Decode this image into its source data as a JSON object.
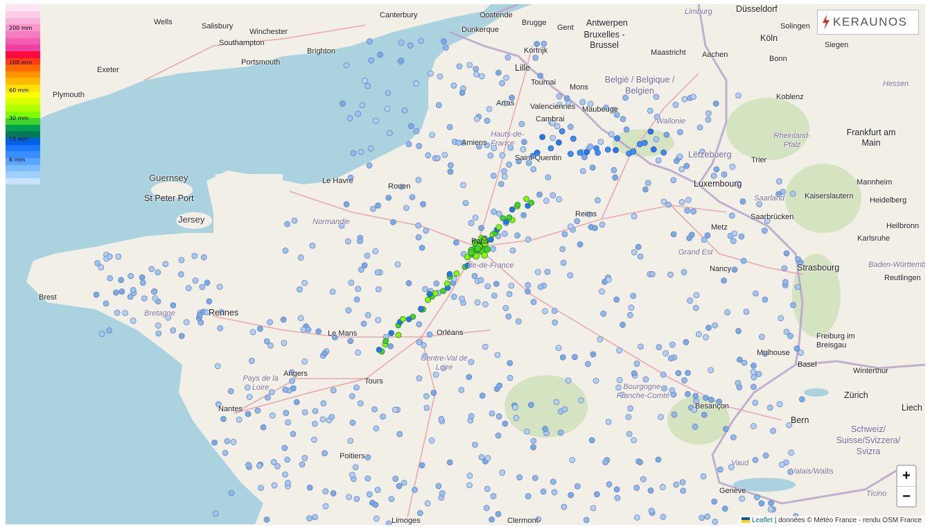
{
  "map": {
    "labels": {
      "wells": "Wells",
      "salisbury": "Salisbury",
      "winchester": "Winchester",
      "canterbury": "Canterbury",
      "oostende": "Oostende",
      "brugge": "Brugge",
      "gent": "Gent",
      "antwerpen": "Antwerpen",
      "brussel": "Bruxelles - Brussel",
      "limburg": "Limburg",
      "dusseldorf": "Düsseldorf",
      "southampton": "Southampton",
      "brighton": "Brighton",
      "dunkerque": "Dunkerque",
      "kortrijk": "Kortrijk",
      "maastricht": "Maastricht",
      "aachen": "Aachen",
      "koln": "Köln",
      "solingen": "Solingen",
      "exeter": "Exeter",
      "portsmouth": "Portsmouth",
      "lille": "Lille",
      "bonn": "Bonn",
      "siegen": "Siegen",
      "belgique": "België / Belgique / Belgien",
      "tournai": "Tournai",
      "mons": "Mons",
      "plymouth": "Plymouth",
      "hessen": "Hessen",
      "arras": "Arras",
      "valenciennes": "Valenciennes",
      "maubeuge": "Maubeuge",
      "koblenz": "Koblenz",
      "cambrai": "Cambrai",
      "wallonie": "Wallonie",
      "frankfurt": "Frankfurt am Main",
      "hautsdefrance": "Hauts-de-France",
      "amiens": "Amiens",
      "rheinland": "Rheinland-Pfalz",
      "letzebuerg": "Lëtzebuerg",
      "trier": "Trier",
      "guernsey": "Guernsey",
      "saintquentin": "Saint-Quentin",
      "stpeterport": "St Peter Port",
      "lehavre": "Le Havre",
      "rouen": "Rouen",
      "luxembourg": "Luxembourg",
      "mannheim": "Mannheim",
      "jersey": "Jersey",
      "kaiserslautern": "Kaiserslautern",
      "saarland": "Saarland",
      "heidelberg": "Heidelberg",
      "normandie": "Normandie",
      "reims": "Reims",
      "saarbrucken": "Saarbrücken",
      "heilbronn": "Heilbronn",
      "metz": "Metz",
      "karlsruhe": "Karlsruhe",
      "grandest": "Grand Est",
      "iledefrance": "Île-de-France",
      "nancy": "Nancy",
      "strasbourg": "Strasbourg",
      "badenwurtt": "Baden-Württemb",
      "reutlingen": "Reutlingen",
      "brest": "Brest",
      "rennes": "Rennes",
      "bretagne": "Bretagne",
      "lemans": "Le Mans",
      "orleans": "Orléans",
      "freiburg": "Freiburg im Breisgau",
      "centrevaldeloire": "Centre-Val de Loire",
      "mulhouse": "Mulhouse",
      "basel": "Basel",
      "angers": "Angers",
      "paysdelaloire": "Pays de la Loire",
      "tours": "Tours",
      "winterthur": "Winterthur",
      "bourgogne": "Bourgogne-Franche-Comté",
      "zurich": "Zürich",
      "nantes": "Nantes",
      "besancon": "Besançon",
      "bern": "Bern",
      "liech": "Liech",
      "schweiz": "Schweiz/ Suisse/Svizzera/ Svizra",
      "poitiers": "Poitiers",
      "vaud": "Vaud",
      "valais": "Valais/Wallis",
      "ticino": "Ticino",
      "geneve": "Genève",
      "limoges": "Limoges",
      "clermont": "Clermont-",
      "paris": "Paris"
    }
  },
  "legend": {
    "labels": [
      "200 mm",
      "100 mm",
      "60 mm",
      "30 mm",
      "15 mm",
      "6 mm"
    ],
    "colors": [
      "#fde6f2",
      "#fbcde6",
      "#f9b3db",
      "#f797cd",
      "#f57cc0",
      "#f25eb2",
      "#ef41a3",
      "#ff0a3a",
      "#ff3c14",
      "#ff6a00",
      "#ff9300",
      "#ffba00",
      "#ffe100",
      "#ffff00",
      "#d9ff00",
      "#b2ff00",
      "#7dff00",
      "#3ed62b",
      "#00a050",
      "#007a5a",
      "#0060e6",
      "#1c78ff",
      "#3a8fff",
      "#5aa5ff",
      "#7dbcff",
      "#a0d0ff",
      "#c8e3ff"
    ]
  },
  "logo": {
    "brand": "KERAUNOS"
  },
  "zoom": {
    "in": "+",
    "out": "−"
  },
  "attribution": {
    "leaflet": "Leaflet",
    "rest": " | données © Météo France - rendu OSM France"
  },
  "colors": {
    "sea": "#aad3df",
    "land": "#f2efe6",
    "border": "#b7a3c9",
    "road": "#e8a0a8",
    "forest": "#c7dfb0"
  }
}
